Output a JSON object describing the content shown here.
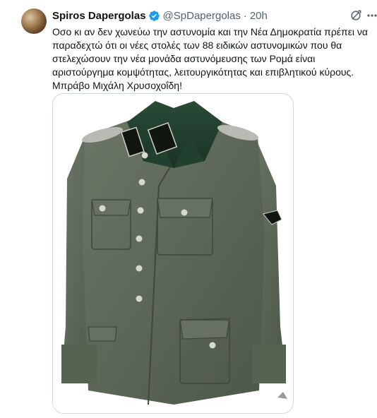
{
  "tweet": {
    "display_name": "Spiros Dapergolas",
    "handle": "@SpDapergolas",
    "separator": "·",
    "time": "20h",
    "text": "Οσο κι αν δεν χωνεύω την αστυνομία και την Νέα Δημοκρατία πρέπει να παραδεχτώ ότι οι νέες στολές των 88 ειδικών αστυνομικών που θα στελεχώσουν την νέα μονάδα αστυνόμευσης των Ρομά είναι αριστούργημα κομψότητας, λειτουργικότητας και επιβλητικού κύρους. Μπράβο Μιχάλη Χρυσοχοΐδη!",
    "verified": true
  },
  "icons": {
    "verified": "verified-badge-icon",
    "grok": "grok-icon",
    "more": "more-icon"
  },
  "colors": {
    "verified": "#1d9bf0",
    "handle": "#536471",
    "text": "#0f1419",
    "border": "#cfd9de",
    "uniform": "#5f6a59",
    "collar": "#1f3b2b"
  }
}
